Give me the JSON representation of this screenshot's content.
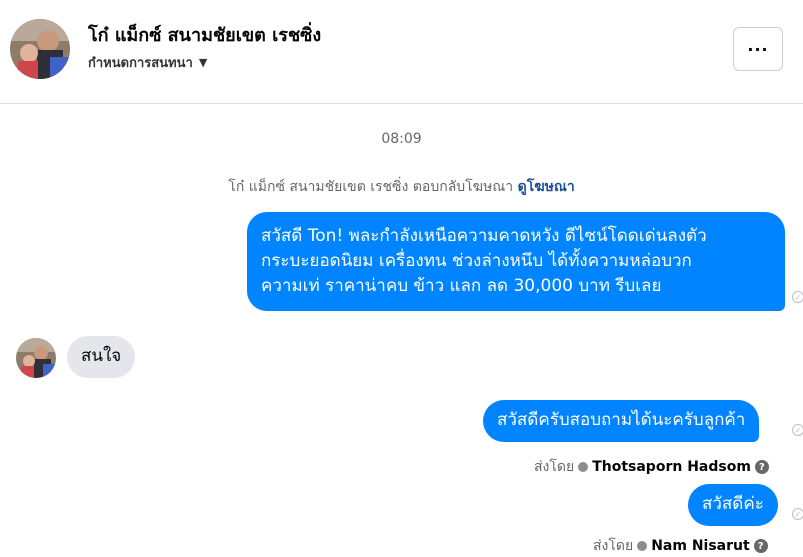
{
  "header": {
    "name": "โก๋ แม็กซ์ สนามชัยเขต เรชซิ่ง",
    "subtitle": "กำหนดการสนทนา",
    "more_label": "···"
  },
  "conversation": {
    "time": "08:09",
    "system_text": "โก๋ แม็กซ์ สนามชัยเขต เรชซิ่ง ตอบกลับโฆษณา",
    "system_link": "ดูโฆษณา",
    "messages": [
      {
        "direction": "outgoing",
        "lines": [
          "สวัสดี Ton! พละกำลังเหนือความคาดหวัง ดีไซน์โดดเด่นลงตัว",
          "กระบะยอดนิยม เครื่องทน ช่วงล่างหนึบ ได้ทั้งความหล่อบวก",
          "ความเท่ ราคาน่าคบ ข้าว แลก ลด 30,000 บาท รีบเลย"
        ]
      },
      {
        "direction": "incoming",
        "text": "สนใจ"
      },
      {
        "direction": "outgoing",
        "text": "สวัสดีครับสอบถามได้นะครับลูกค้า",
        "sent_by_label": "ส่งโดย",
        "sent_by_name": "Thotsaporn Hadsom"
      },
      {
        "direction": "outgoing",
        "text": "สวัสดีค่ะ",
        "sent_by_label": "ส่งโดย",
        "sent_by_name": "Nam Nisarut"
      }
    ]
  },
  "colors": {
    "outgoing_bubble": "#0084ff",
    "incoming_bubble": "#e4e6eb",
    "link": "#1c4f9c"
  },
  "icons": [
    "avatar-photo",
    "caret-down-icon",
    "more-options-icon",
    "sent-check-icon",
    "agent-dot-icon",
    "info-icon"
  ]
}
